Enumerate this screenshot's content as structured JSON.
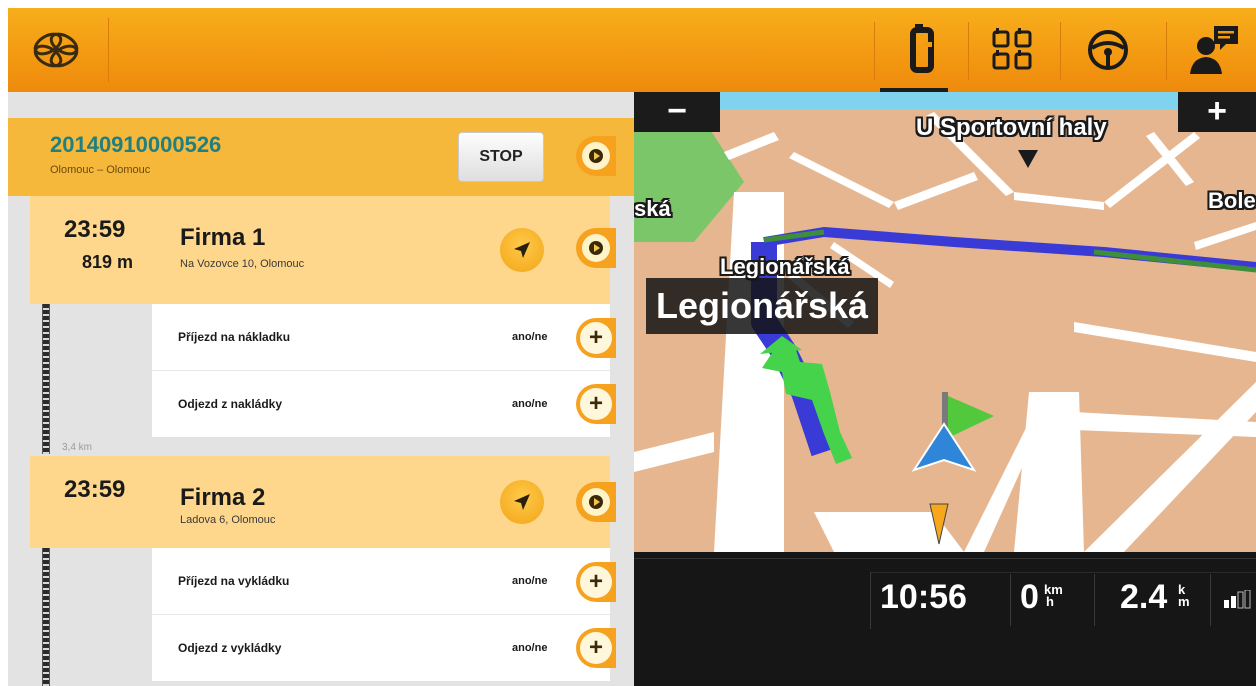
{
  "route": {
    "id": "20140910000526",
    "subtitle": "Olomouc – Olomouc",
    "stop_label": "STOP"
  },
  "stops": [
    {
      "time": "23:59",
      "distance": "819 m",
      "name": "Firma 1",
      "address": "Na Vozovce 10, Olomouc",
      "tasks": [
        {
          "label": "Příjezd na nákladku",
          "value": "ano/ne"
        },
        {
          "label": "Odjezd z nakládky",
          "value": "ano/ne"
        }
      ]
    },
    {
      "time": "23:59",
      "name": "Firma 2",
      "address": "Ladova 6, Olomouc",
      "tasks": [
        {
          "label": "Příjezd na vykládku",
          "value": "ano/ne"
        },
        {
          "label": "Odjezd z vykládky",
          "value": "ano/ne"
        }
      ]
    }
  ],
  "segment_distance": "3,4 km",
  "map": {
    "zoom_out": "−",
    "zoom_in": "+",
    "labels": {
      "u_sportovni_haly": "U Sportovní haly",
      "left_partial": "ská",
      "right_partial": "Bole",
      "legionarska_small": "Legionářská"
    },
    "current_street": "Legionářská"
  },
  "status": {
    "time": "10:56",
    "speed": "0",
    "speed_unit_top": "km",
    "speed_unit_bottom": "h",
    "distance": "2.4",
    "distance_unit_top": "k",
    "distance_unit_bottom": "m"
  },
  "toolbar": {
    "icons": [
      "route-icon",
      "stops-grid-icon",
      "steering-wheel-icon",
      "driver-message-icon"
    ],
    "active": "route-icon"
  },
  "colors": {
    "toolbar": "#f39a12",
    "route_header": "#f6b83a",
    "stop_card": "#ffd78c",
    "route_id": "#217f80",
    "route_line": "#3a3ad6",
    "guidance_arrow": "#44d34a"
  }
}
